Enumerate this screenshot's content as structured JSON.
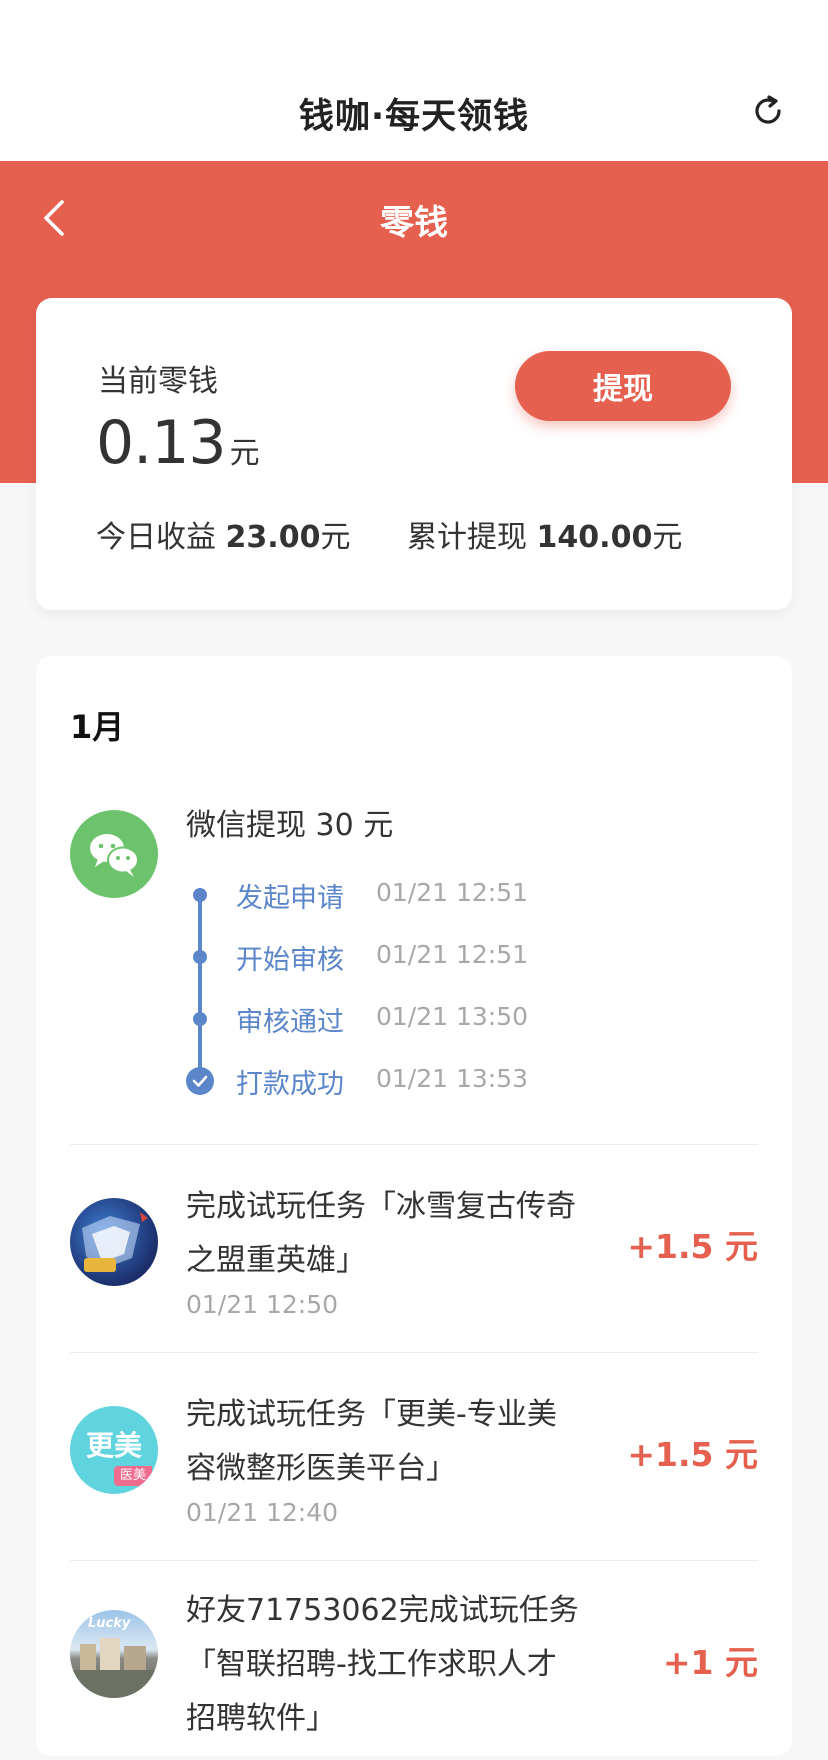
{
  "app": {
    "title": "钱咖·每天领钱"
  },
  "header": {
    "title": "零钱"
  },
  "balance": {
    "label": "当前零钱",
    "amount": "0.13",
    "unit": "元",
    "withdraw_label": "提现",
    "today_label": "今日收益",
    "today_value": "23.00",
    "today_unit": "元",
    "total_label": "累计提现",
    "total_value": "140.00",
    "total_unit": "元"
  },
  "records": {
    "month": "1月",
    "withdrawal": {
      "title": "微信提现 30 元",
      "icon": "wechat-icon",
      "steps": [
        {
          "label": "发起申请",
          "time": "01/21 12:51"
        },
        {
          "label": "开始审核",
          "time": "01/21 12:51"
        },
        {
          "label": "审核通过",
          "time": "01/21 13:50"
        },
        {
          "label": "打款成功",
          "time": "01/21 13:53"
        }
      ]
    },
    "tasks": [
      {
        "title_line1": "完成试玩任务「冰雪复古传奇",
        "title_line2": "之盟重英雄」",
        "time": "01/21 12:50",
        "amount": "+1.5 元",
        "icon": "game-icon"
      },
      {
        "title_line1": "完成试玩任务「更美-专业美",
        "title_line2": "容微整形医美平台」",
        "time": "01/21 12:40",
        "amount": "+1.5 元",
        "icon": "gengmei-icon",
        "icon_text": "更美",
        "icon_sub": "医美"
      },
      {
        "title_line1": "好友71753062完成试玩任务",
        "title_line2": "「智联招聘-找工作求职人才",
        "title_line3": "招聘软件」",
        "amount": "+1 元",
        "icon": "zhilian-icon",
        "icon_text": "Lucky"
      }
    ]
  },
  "colors": {
    "accent": "#e5604f",
    "timeline": "#5b86c9",
    "wechat": "#6cc36b"
  }
}
